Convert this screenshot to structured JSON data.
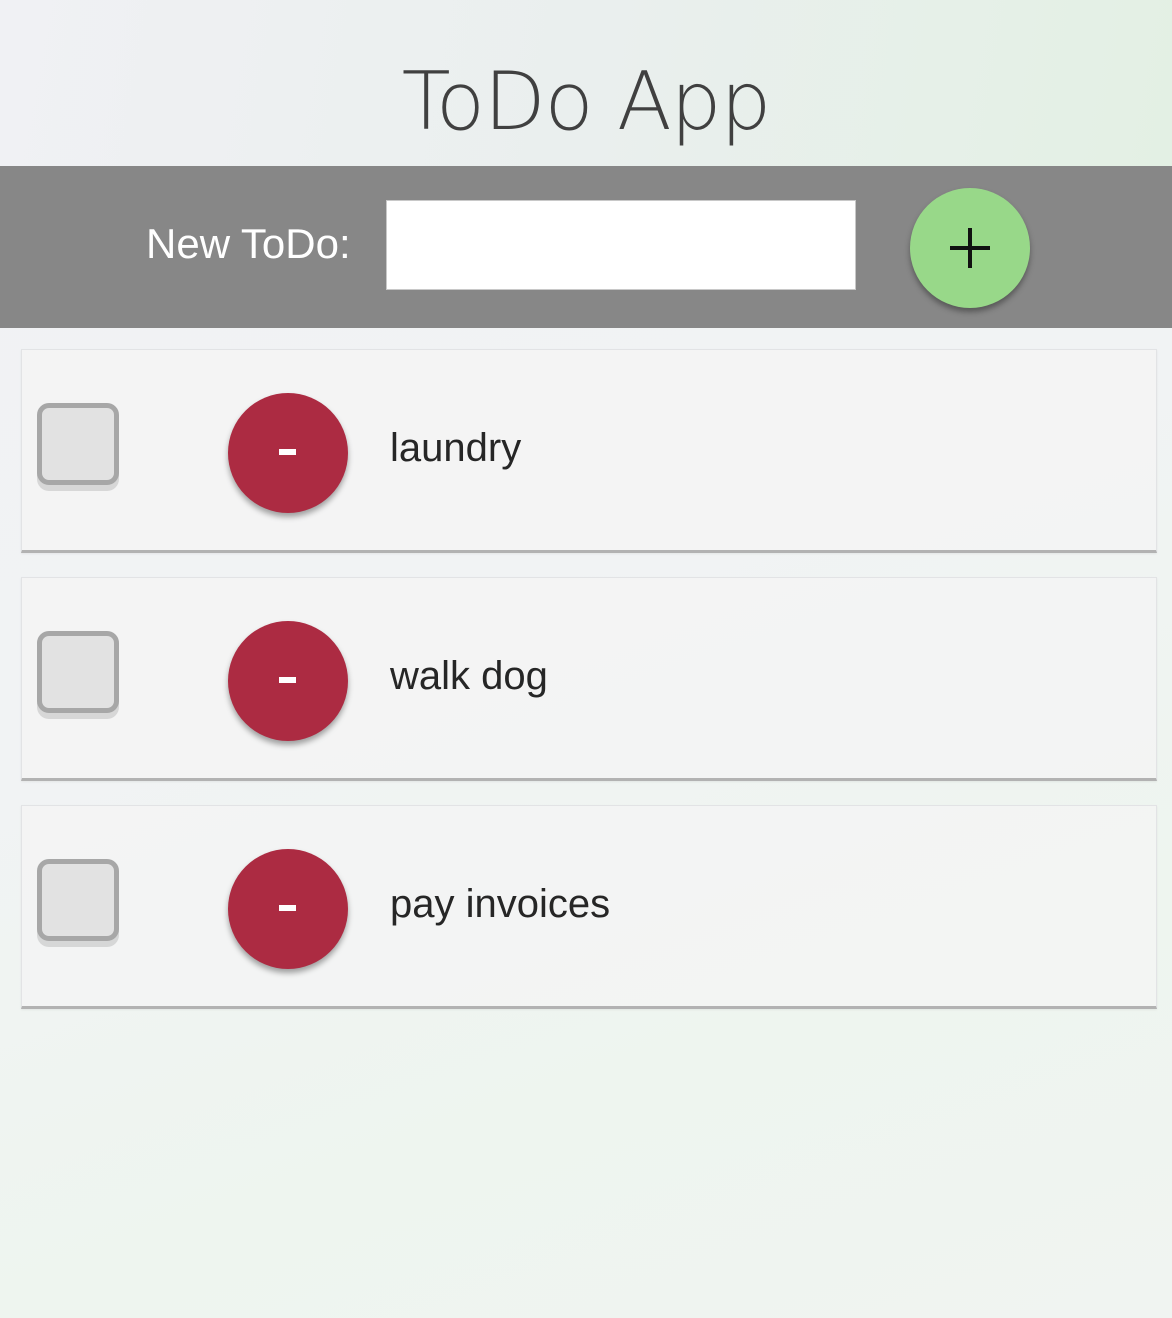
{
  "app": {
    "title": "ToDo App"
  },
  "header": {
    "new_label": "New ToDo:",
    "input_value": "",
    "input_placeholder": "",
    "add_icon": "plus-icon"
  },
  "todos": [
    {
      "text": "laundry",
      "checked": false,
      "remove_icon": "minus-icon"
    },
    {
      "text": "walk dog",
      "checked": false,
      "remove_icon": "minus-icon"
    },
    {
      "text": "pay invoices",
      "checked": false,
      "remove_icon": "minus-icon"
    }
  ],
  "colors": {
    "header_bar": "#878787",
    "add_button": "#98d889",
    "remove_button": "#ac2b42",
    "checkbox_border": "#a7a7a7",
    "checkbox_fill": "#e2e2e2"
  }
}
